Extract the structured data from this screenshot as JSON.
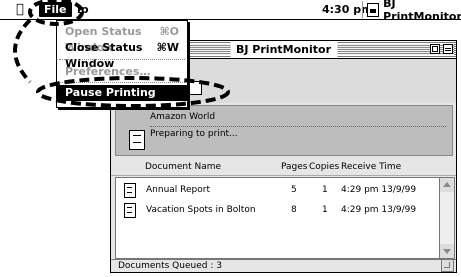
{
  "menubar": {
    "apple_glyph": "",
    "file_label": "File",
    "help_label": "lp",
    "clock": "4:30 pm",
    "active_app": "BJ PrintMonitor"
  },
  "file_menu": {
    "items": [
      {
        "label": "Open Status Window",
        "shortcut": "⌘O",
        "enabled": false
      },
      {
        "label": "Close Status Window",
        "shortcut": "⌘W",
        "enabled": true
      },
      {
        "label": "Preferences…",
        "shortcut": "",
        "enabled": false
      },
      {
        "label": "Pause Printing",
        "shortcut": "",
        "enabled": true,
        "selected": true
      }
    ]
  },
  "window": {
    "title": "BJ PrintMonitor",
    "current_job": {
      "name": "Amazon World",
      "status": "Preparing to print..."
    },
    "columns": {
      "name": "Document Name",
      "pages": "Pages",
      "copies": "Copies",
      "time": "Receive Time"
    },
    "jobs": [
      {
        "name": "Annual Report",
        "pages": "5",
        "copies": "1",
        "time": "4:29 pm 13/9/99"
      },
      {
        "name": "Vacation Spots in Bolton",
        "pages": "8",
        "copies": "1",
        "time": "4:29 pm 13/9/99"
      }
    ],
    "status_text": "Documents Queued : 3"
  },
  "colors": {
    "panel_gray": "#bdbdbd",
    "window_gray": "#e6e6e6",
    "highlight": "#000000"
  }
}
